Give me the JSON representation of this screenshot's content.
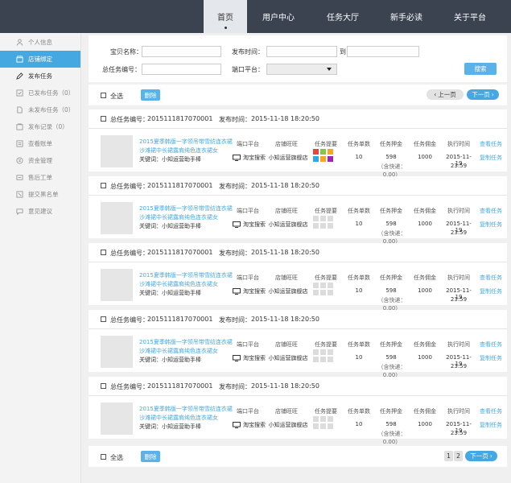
{
  "nav": {
    "items": [
      {
        "label": "首页",
        "active": true
      },
      {
        "label": "用户中心"
      },
      {
        "label": "任务大厅"
      },
      {
        "label": "新手必读"
      },
      {
        "label": "关于平台"
      }
    ]
  },
  "sidebar": {
    "items": [
      {
        "label": "个人信息",
        "icon": "user-icon"
      },
      {
        "label": "店铺绑定",
        "icon": "store-icon",
        "active": true
      },
      {
        "label": "发布任务",
        "icon": "edit-icon"
      },
      {
        "label": "已发布任务（0）",
        "icon": "check-icon"
      },
      {
        "label": "未发布任务（0）",
        "icon": "file-icon"
      },
      {
        "label": "发布记录（0）",
        "icon": "record-icon"
      },
      {
        "label": "查看账单",
        "icon": "bill-icon"
      },
      {
        "label": "资金管理",
        "icon": "money-icon"
      },
      {
        "label": "售后工单",
        "icon": "ticket-icon"
      },
      {
        "label": "提交黑名单",
        "icon": "blacklist-icon"
      },
      {
        "label": "意见建议",
        "icon": "message-icon"
      }
    ]
  },
  "search": {
    "item_name_label": "宝贝名称：",
    "item_name_value": "",
    "publish_time_label": "发布时间：",
    "to_label": "到",
    "task_no_label": "总任务编号：",
    "port_label": "端口平台：",
    "port_value": "",
    "search_button": "搜索"
  },
  "toolbar": {
    "select_all": "全选",
    "delete": "删除",
    "prev_page": "上一页",
    "next_page": "下一页"
  },
  "tasks": {
    "header_labels": {
      "task_no": "总任务编号：",
      "publish_time": "发布时间："
    },
    "column_labels": {
      "port": "端口平台",
      "shop": "店铺旺旺",
      "summary": "任务提要",
      "count": "任务单数",
      "deposit": "任务押金",
      "commission": "任务佣金",
      "exec_time": "执行时间"
    },
    "action_labels": {
      "view": "查看任务",
      "copy": "复制任务"
    },
    "list": [
      {
        "task_no": "2015111817070001",
        "publish_time": "2015-11-18  18:20:50",
        "title": "2015夏季韩版一字领吊带雪纺连衣裙沙滩裙中长裙露肩纯色连衣裙女",
        "keyword": "关键词：小知运营助手棒",
        "port": "淘宝搜索",
        "shop": "小知运营旗舰店",
        "count": "10",
        "deposit": "598",
        "deposit_note": "（含快递：0.00）",
        "commission": "1000",
        "exec_date": "2015-11-19",
        "exec_time": "23:59",
        "colored_tags": true
      },
      {
        "task_no": "2015111817070001",
        "publish_time": "2015-11-18  18:20:50",
        "title": "2015夏季韩版一字领吊带雪纺连衣裙沙滩裙中长裙露肩纯色连衣裙女",
        "keyword": "关键词：小知运营助手棒",
        "port": "淘宝搜索",
        "shop": "小知运营旗舰店",
        "count": "10",
        "deposit": "598",
        "deposit_note": "（含快递：0.00）",
        "commission": "1000",
        "exec_date": "2015-11-19",
        "exec_time": "23:59",
        "colored_tags": false
      },
      {
        "task_no": "2015111817070001",
        "publish_time": "2015-11-18  18:20:50",
        "title": "2015夏季韩版一字领吊带雪纺连衣裙沙滩裙中长裙露肩纯色连衣裙女",
        "keyword": "关键词：小知运营助手棒",
        "port": "淘宝搜索",
        "shop": "小知运营旗舰店",
        "count": "10",
        "deposit": "598",
        "deposit_note": "（含快递：0.00）",
        "commission": "1000",
        "exec_date": "2015-11-19",
        "exec_time": "23:59",
        "colored_tags": false
      },
      {
        "task_no": "2015111817070001",
        "publish_time": "2015-11-18  18:20:50",
        "title": "2015夏季韩版一字领吊带雪纺连衣裙沙滩裙中长裙露肩纯色连衣裙女",
        "keyword": "关键词：小知运营助手棒",
        "port": "淘宝搜索",
        "shop": "小知运营旗舰店",
        "count": "10",
        "deposit": "598",
        "deposit_note": "（含快递：0.00）",
        "commission": "1000",
        "exec_date": "2015-11-19",
        "exec_time": "23:59",
        "colored_tags": false
      },
      {
        "task_no": "2015111817070001",
        "publish_time": "2015-11-18  18:20:50",
        "title": "2015夏季韩版一字领吊带雪纺连衣裙沙滩裙中长裙露肩纯色连衣裙女",
        "keyword": "关键词：小知运营助手棒",
        "port": "淘宝搜索",
        "shop": "小知运营旗舰店",
        "count": "10",
        "deposit": "598",
        "deposit_note": "（含快递：0.00）",
        "commission": "1000",
        "exec_date": "2015-11-19",
        "exec_time": "23:59",
        "colored_tags": false
      }
    ]
  },
  "pagination": {
    "pages": [
      "1",
      "2"
    ],
    "current": "1"
  },
  "colors": {
    "topbar": "#3b4350",
    "accent": "#46a8e0",
    "tag_colors": [
      "#e8453c",
      "#8bc34a",
      "#f5a623",
      "#2ea8e0",
      "#f5a623",
      "#9c27b0"
    ]
  }
}
